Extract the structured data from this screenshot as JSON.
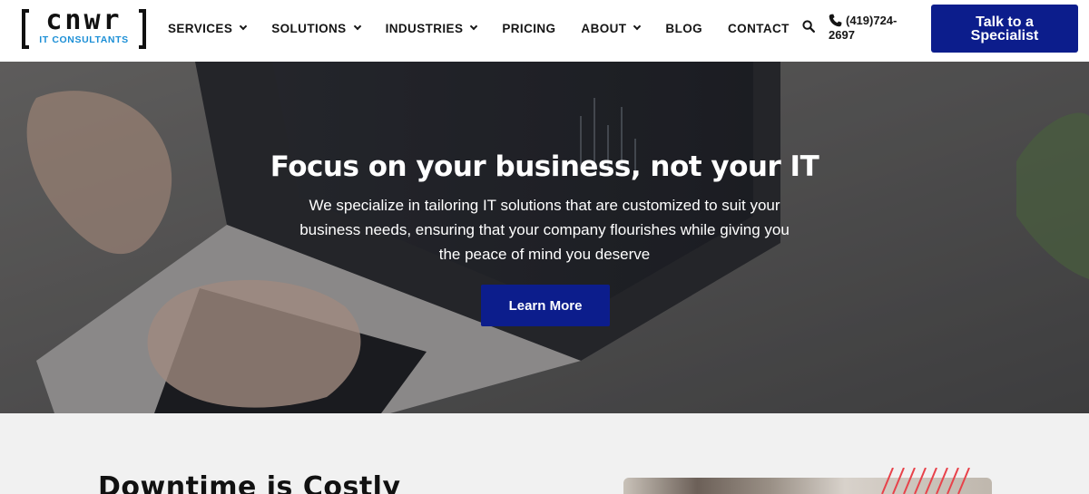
{
  "header": {
    "logo": {
      "wordmark": "cnwr",
      "subtitle": "IT CONSULTANTS"
    },
    "nav": [
      {
        "label": "SERVICES",
        "has_dropdown": true
      },
      {
        "label": "SOLUTIONS",
        "has_dropdown": true
      },
      {
        "label": "INDUSTRIES",
        "has_dropdown": true
      },
      {
        "label": "PRICING",
        "has_dropdown": false
      },
      {
        "label": "ABOUT",
        "has_dropdown": true
      },
      {
        "label": "BLOG",
        "has_dropdown": false
      },
      {
        "label": "CONTACT",
        "has_dropdown": false
      }
    ],
    "search_icon": "search-icon",
    "phone": {
      "icon": "phone-icon",
      "number": "(419)724-2697"
    },
    "cta_label": "Talk to a Specialist"
  },
  "hero": {
    "title": "Focus on your business, not your IT",
    "text": "We specialize in tailoring IT solutions that are customized to suit your business needs, ensuring that your company flourishes while giving you the peace of mind you deserve",
    "button_label": "Learn More"
  },
  "section": {
    "title": "Downtime is Costly"
  },
  "colors": {
    "brand_blue": "#0c1d8c",
    "logo_accent": "#1c8fd6",
    "stripe_red": "#e8424a"
  }
}
